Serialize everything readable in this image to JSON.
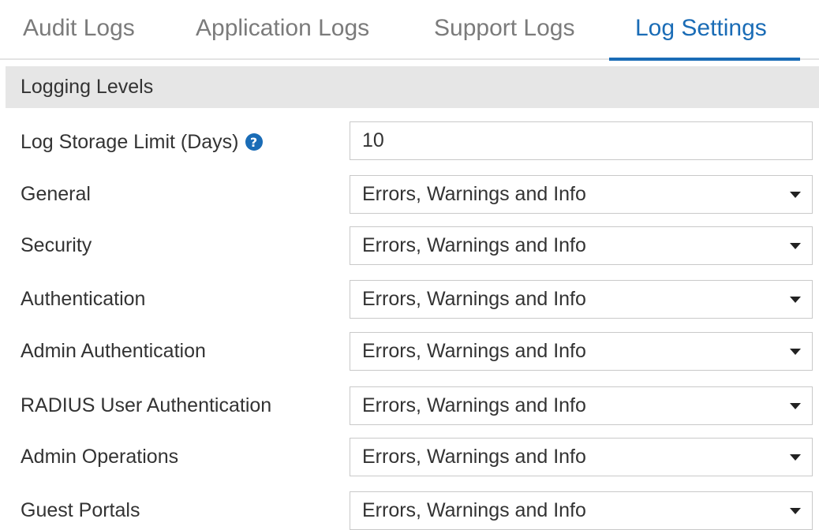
{
  "tabs": {
    "audit": "Audit Logs",
    "application": "Application Logs",
    "support": "Support Logs",
    "settings": "Log Settings"
  },
  "active_tab": "Log Settings",
  "colors": {
    "accent": "#1a6cb6",
    "section_bg": "#e6e6e6"
  },
  "section": {
    "title": "Logging Levels"
  },
  "storage": {
    "label": "Log Storage Limit (Days)",
    "help_icon": "question-circle-icon",
    "value": "10"
  },
  "rows": [
    {
      "label": "General",
      "value": "Errors, Warnings and Info"
    },
    {
      "label": "Security",
      "value": "Errors, Warnings and Info"
    },
    {
      "label": "Authentication",
      "value": "Errors, Warnings and Info"
    },
    {
      "label": "Admin Authentication",
      "value": "Errors, Warnings and Info"
    },
    {
      "label": "RADIUS User Authentication",
      "value": "Errors, Warnings and Info"
    },
    {
      "label": "Admin Operations",
      "value": "Errors, Warnings and Info"
    },
    {
      "label": "Guest Portals",
      "value": "Errors, Warnings and Info"
    }
  ]
}
